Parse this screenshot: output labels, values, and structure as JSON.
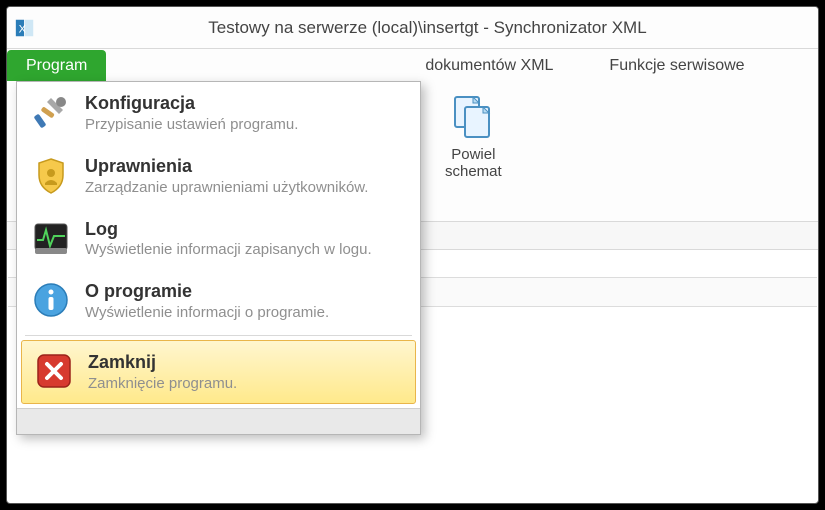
{
  "window": {
    "title": "Testowy na serwerze (local)\\insertgt - Synchronizator XML"
  },
  "tabs": {
    "program": "Program",
    "other1": "dokumentów XML",
    "other2": "Funkcje serwisowe"
  },
  "ribbon": {
    "powiel_schemat_line1": "Powiel",
    "powiel_schemat_line2": "schemat"
  },
  "menu": {
    "konfiguracja": {
      "title": "Konfiguracja",
      "desc": "Przypisanie ustawień programu."
    },
    "uprawnienia": {
      "title": "Uprawnienia",
      "desc": "Zarządzanie uprawnieniami użytkowników."
    },
    "log": {
      "title": "Log",
      "desc": "Wyświetlenie informacji zapisanych w logu."
    },
    "oprogramie": {
      "title": "O programie",
      "desc": "Wyświetlenie informacji o programie."
    },
    "zamknij": {
      "title": "Zamknij",
      "desc": "Zamknięcie programu."
    }
  }
}
